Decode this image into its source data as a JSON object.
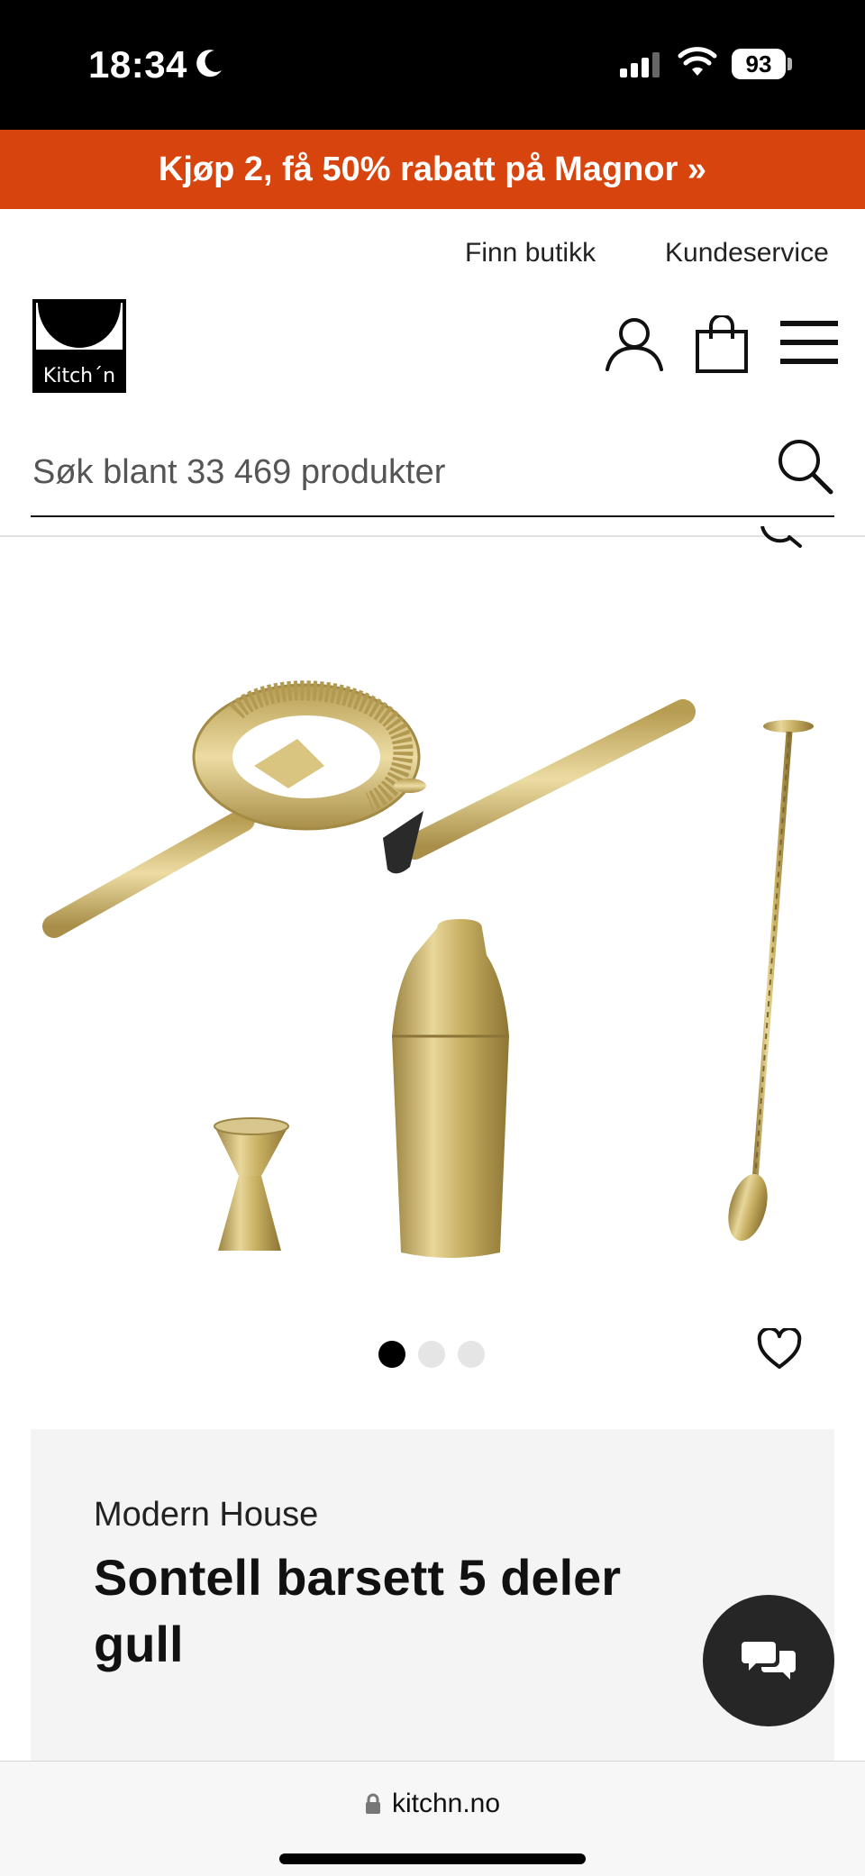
{
  "status_bar": {
    "time": "18:34",
    "battery": "93"
  },
  "promo": {
    "text": "Kjøp 2, få 50% rabatt på Magnor »"
  },
  "top_links": {
    "store": "Finn butikk",
    "service": "Kundeservice"
  },
  "logo": {
    "text": "Kitch´n"
  },
  "search": {
    "placeholder": "Søk blant 33 469 produkter"
  },
  "carousel": {
    "total": 3,
    "active": 1
  },
  "product": {
    "brand": "Modern House",
    "title": "Sontell barsett 5 deler gull"
  },
  "browser": {
    "url": "kitchn.no"
  },
  "colors": {
    "promo": "#d8440e",
    "gold": "#c9b15a",
    "panel": "#f4f4f4"
  },
  "icons": [
    "moon-icon",
    "signal-icon",
    "wifi-icon",
    "user-icon",
    "bag-icon",
    "menu-icon",
    "search-icon",
    "heart-icon",
    "chat-icon",
    "lock-icon"
  ]
}
